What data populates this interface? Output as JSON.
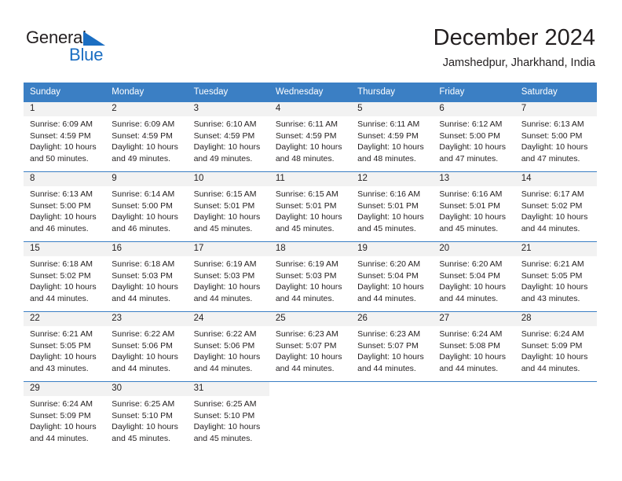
{
  "brand": {
    "name_top": "General",
    "name_bottom": "Blue",
    "accent_color": "#1b6ec2",
    "triangle_icon": "triangle-icon"
  },
  "header": {
    "title": "December 2024",
    "subtitle": "Jamshedpur, Jharkhand, India"
  },
  "calendar": {
    "header_bg": "#3b7fc4",
    "day_bar_bg": "#f2f2f2",
    "weekdays": [
      "Sunday",
      "Monday",
      "Tuesday",
      "Wednesday",
      "Thursday",
      "Friday",
      "Saturday"
    ],
    "weeks": [
      [
        {
          "day": "1",
          "sunrise": "Sunrise: 6:09 AM",
          "sunset": "Sunset: 4:59 PM",
          "daylight1": "Daylight: 10 hours",
          "daylight2": "and 50 minutes."
        },
        {
          "day": "2",
          "sunrise": "Sunrise: 6:09 AM",
          "sunset": "Sunset: 4:59 PM",
          "daylight1": "Daylight: 10 hours",
          "daylight2": "and 49 minutes."
        },
        {
          "day": "3",
          "sunrise": "Sunrise: 6:10 AM",
          "sunset": "Sunset: 4:59 PM",
          "daylight1": "Daylight: 10 hours",
          "daylight2": "and 49 minutes."
        },
        {
          "day": "4",
          "sunrise": "Sunrise: 6:11 AM",
          "sunset": "Sunset: 4:59 PM",
          "daylight1": "Daylight: 10 hours",
          "daylight2": "and 48 minutes."
        },
        {
          "day": "5",
          "sunrise": "Sunrise: 6:11 AM",
          "sunset": "Sunset: 4:59 PM",
          "daylight1": "Daylight: 10 hours",
          "daylight2": "and 48 minutes."
        },
        {
          "day": "6",
          "sunrise": "Sunrise: 6:12 AM",
          "sunset": "Sunset: 5:00 PM",
          "daylight1": "Daylight: 10 hours",
          "daylight2": "and 47 minutes."
        },
        {
          "day": "7",
          "sunrise": "Sunrise: 6:13 AM",
          "sunset": "Sunset: 5:00 PM",
          "daylight1": "Daylight: 10 hours",
          "daylight2": "and 47 minutes."
        }
      ],
      [
        {
          "day": "8",
          "sunrise": "Sunrise: 6:13 AM",
          "sunset": "Sunset: 5:00 PM",
          "daylight1": "Daylight: 10 hours",
          "daylight2": "and 46 minutes."
        },
        {
          "day": "9",
          "sunrise": "Sunrise: 6:14 AM",
          "sunset": "Sunset: 5:00 PM",
          "daylight1": "Daylight: 10 hours",
          "daylight2": "and 46 minutes."
        },
        {
          "day": "10",
          "sunrise": "Sunrise: 6:15 AM",
          "sunset": "Sunset: 5:01 PM",
          "daylight1": "Daylight: 10 hours",
          "daylight2": "and 45 minutes."
        },
        {
          "day": "11",
          "sunrise": "Sunrise: 6:15 AM",
          "sunset": "Sunset: 5:01 PM",
          "daylight1": "Daylight: 10 hours",
          "daylight2": "and 45 minutes."
        },
        {
          "day": "12",
          "sunrise": "Sunrise: 6:16 AM",
          "sunset": "Sunset: 5:01 PM",
          "daylight1": "Daylight: 10 hours",
          "daylight2": "and 45 minutes."
        },
        {
          "day": "13",
          "sunrise": "Sunrise: 6:16 AM",
          "sunset": "Sunset: 5:01 PM",
          "daylight1": "Daylight: 10 hours",
          "daylight2": "and 45 minutes."
        },
        {
          "day": "14",
          "sunrise": "Sunrise: 6:17 AM",
          "sunset": "Sunset: 5:02 PM",
          "daylight1": "Daylight: 10 hours",
          "daylight2": "and 44 minutes."
        }
      ],
      [
        {
          "day": "15",
          "sunrise": "Sunrise: 6:18 AM",
          "sunset": "Sunset: 5:02 PM",
          "daylight1": "Daylight: 10 hours",
          "daylight2": "and 44 minutes."
        },
        {
          "day": "16",
          "sunrise": "Sunrise: 6:18 AM",
          "sunset": "Sunset: 5:03 PM",
          "daylight1": "Daylight: 10 hours",
          "daylight2": "and 44 minutes."
        },
        {
          "day": "17",
          "sunrise": "Sunrise: 6:19 AM",
          "sunset": "Sunset: 5:03 PM",
          "daylight1": "Daylight: 10 hours",
          "daylight2": "and 44 minutes."
        },
        {
          "day": "18",
          "sunrise": "Sunrise: 6:19 AM",
          "sunset": "Sunset: 5:03 PM",
          "daylight1": "Daylight: 10 hours",
          "daylight2": "and 44 minutes."
        },
        {
          "day": "19",
          "sunrise": "Sunrise: 6:20 AM",
          "sunset": "Sunset: 5:04 PM",
          "daylight1": "Daylight: 10 hours",
          "daylight2": "and 44 minutes."
        },
        {
          "day": "20",
          "sunrise": "Sunrise: 6:20 AM",
          "sunset": "Sunset: 5:04 PM",
          "daylight1": "Daylight: 10 hours",
          "daylight2": "and 44 minutes."
        },
        {
          "day": "21",
          "sunrise": "Sunrise: 6:21 AM",
          "sunset": "Sunset: 5:05 PM",
          "daylight1": "Daylight: 10 hours",
          "daylight2": "and 43 minutes."
        }
      ],
      [
        {
          "day": "22",
          "sunrise": "Sunrise: 6:21 AM",
          "sunset": "Sunset: 5:05 PM",
          "daylight1": "Daylight: 10 hours",
          "daylight2": "and 43 minutes."
        },
        {
          "day": "23",
          "sunrise": "Sunrise: 6:22 AM",
          "sunset": "Sunset: 5:06 PM",
          "daylight1": "Daylight: 10 hours",
          "daylight2": "and 44 minutes."
        },
        {
          "day": "24",
          "sunrise": "Sunrise: 6:22 AM",
          "sunset": "Sunset: 5:06 PM",
          "daylight1": "Daylight: 10 hours",
          "daylight2": "and 44 minutes."
        },
        {
          "day": "25",
          "sunrise": "Sunrise: 6:23 AM",
          "sunset": "Sunset: 5:07 PM",
          "daylight1": "Daylight: 10 hours",
          "daylight2": "and 44 minutes."
        },
        {
          "day": "26",
          "sunrise": "Sunrise: 6:23 AM",
          "sunset": "Sunset: 5:07 PM",
          "daylight1": "Daylight: 10 hours",
          "daylight2": "and 44 minutes."
        },
        {
          "day": "27",
          "sunrise": "Sunrise: 6:24 AM",
          "sunset": "Sunset: 5:08 PM",
          "daylight1": "Daylight: 10 hours",
          "daylight2": "and 44 minutes."
        },
        {
          "day": "28",
          "sunrise": "Sunrise: 6:24 AM",
          "sunset": "Sunset: 5:09 PM",
          "daylight1": "Daylight: 10 hours",
          "daylight2": "and 44 minutes."
        }
      ],
      [
        {
          "day": "29",
          "sunrise": "Sunrise: 6:24 AM",
          "sunset": "Sunset: 5:09 PM",
          "daylight1": "Daylight: 10 hours",
          "daylight2": "and 44 minutes."
        },
        {
          "day": "30",
          "sunrise": "Sunrise: 6:25 AM",
          "sunset": "Sunset: 5:10 PM",
          "daylight1": "Daylight: 10 hours",
          "daylight2": "and 45 minutes."
        },
        {
          "day": "31",
          "sunrise": "Sunrise: 6:25 AM",
          "sunset": "Sunset: 5:10 PM",
          "daylight1": "Daylight: 10 hours",
          "daylight2": "and 45 minutes."
        },
        {
          "day": "",
          "sunrise": "",
          "sunset": "",
          "daylight1": "",
          "daylight2": ""
        },
        {
          "day": "",
          "sunrise": "",
          "sunset": "",
          "daylight1": "",
          "daylight2": ""
        },
        {
          "day": "",
          "sunrise": "",
          "sunset": "",
          "daylight1": "",
          "daylight2": ""
        },
        {
          "day": "",
          "sunrise": "",
          "sunset": "",
          "daylight1": "",
          "daylight2": ""
        }
      ]
    ]
  }
}
